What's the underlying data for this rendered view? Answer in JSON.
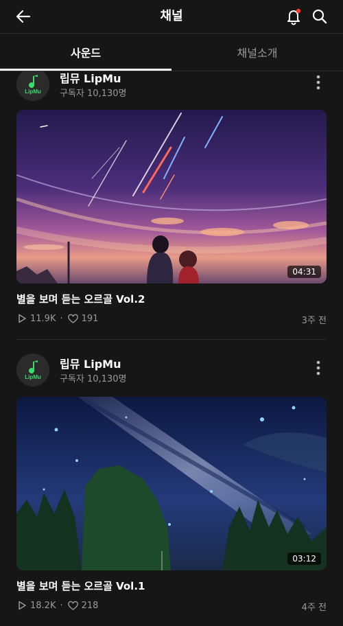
{
  "header": {
    "title": "채널"
  },
  "tabs": [
    {
      "label": "사운드",
      "active": true
    },
    {
      "label": "채널소개",
      "active": false
    }
  ],
  "colors": {
    "background": "#161616",
    "notification_dot": "#ff3b30",
    "muted_text": "#9a9a9a",
    "logo_green": "#3ddc6b"
  },
  "icons": [
    "back-arrow-icon",
    "bell-icon",
    "search-icon",
    "more-vert-icon",
    "play-icon",
    "heart-icon"
  ],
  "cards": [
    {
      "channel_name": "립뮤 LipMu",
      "subscribers": "구독자 10,130명",
      "duration": "04:31",
      "title": "별을 보며 듣는 오르골 Vol.2",
      "plays": "11.9K",
      "separator": "·",
      "likes": "191",
      "age": "3주 전"
    },
    {
      "channel_name": "립뮤 LipMu",
      "subscribers": "구독자 10,130명",
      "duration": "03:12",
      "title": "별을 보며 듣는 오르골 Vol.1",
      "plays": "18.2K",
      "separator": "·",
      "likes": "218",
      "age": "4주 전"
    }
  ]
}
